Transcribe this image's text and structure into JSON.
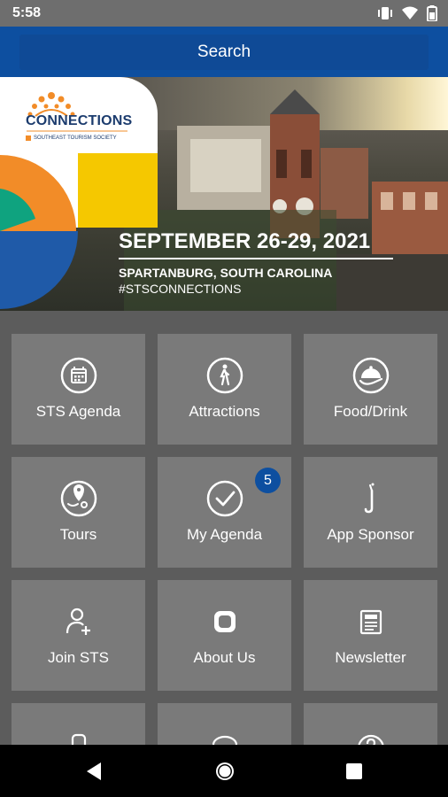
{
  "status_bar": {
    "time": "5:58",
    "icons": [
      "vibrate-icon",
      "wifi-icon",
      "battery-icon"
    ]
  },
  "header": {
    "search_label": "Search",
    "color": "#0d4fa0"
  },
  "banner": {
    "brand": "CONNECTIONS",
    "brand_sub": "SOUTHEAST TOURISM SOCIETY",
    "dates": "SEPTEMBER 26-29, 2021",
    "location": "SPARTANBURG, SOUTH CAROLINA",
    "hashtag": "#STSCONNECTIONS"
  },
  "tiles": [
    {
      "label": "STS Agenda",
      "icon": "calendar-icon"
    },
    {
      "label": "Attractions",
      "icon": "walking-person-icon"
    },
    {
      "label": "Food/Drink",
      "icon": "cloche-icon"
    },
    {
      "label": "Tours",
      "icon": "map-pin-icon"
    },
    {
      "label": "My Agenda",
      "icon": "checkmark-icon",
      "badge": "5"
    },
    {
      "label": "App Sponsor",
      "icon": "sponsor-icon"
    },
    {
      "label": "Join STS",
      "icon": "add-user-icon"
    },
    {
      "label": "About Us",
      "icon": "app-square-icon"
    },
    {
      "label": "Newsletter",
      "icon": "newspaper-icon"
    }
  ],
  "nav": {
    "icons": [
      "back-icon",
      "home-icon",
      "recents-icon"
    ]
  }
}
